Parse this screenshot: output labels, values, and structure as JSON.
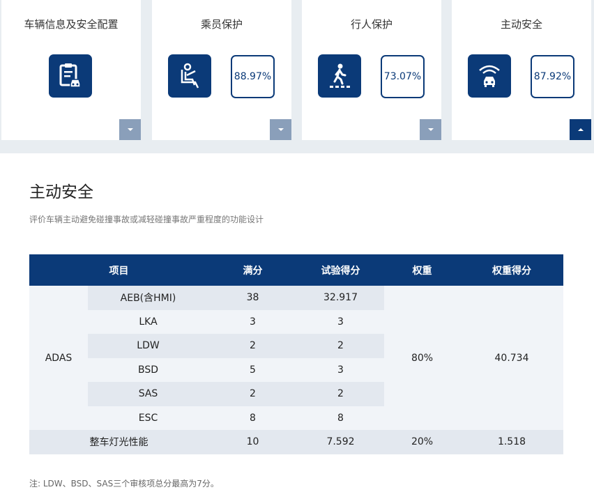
{
  "cards": [
    {
      "title": "车辆信息及安全配置",
      "icon": "clipboard-car-icon",
      "percent": "",
      "expanded": false
    },
    {
      "title": "乘员保护",
      "icon": "seated-occupant-icon",
      "percent": "88.97%",
      "expanded": false
    },
    {
      "title": "行人保护",
      "icon": "pedestrian-icon",
      "percent": "73.07%",
      "expanded": false
    },
    {
      "title": "主动安全",
      "icon": "car-radar-icon",
      "percent": "87.92%",
      "expanded": true
    }
  ],
  "section": {
    "title": "主动安全",
    "description": "评价车辆主动避免碰撞事故或减轻碰撞事故严重程度的功能设计",
    "note": "注: LDW、BSD、SAS三个审核项总分最高为7分。"
  },
  "table": {
    "headers": {
      "item": "项目",
      "full": "满分",
      "test": "试验得分",
      "weight": "权重",
      "weighted": "权重得分"
    },
    "group": {
      "name": "ADAS",
      "weight": "80%",
      "weighted": "40.734"
    },
    "rows": [
      {
        "name": "AEB(含HMI)",
        "full": "38",
        "test": "32.917"
      },
      {
        "name": "LKA",
        "full": "3",
        "test": "3"
      },
      {
        "name": "LDW",
        "full": "2",
        "test": "2"
      },
      {
        "name": "BSD",
        "full": "5",
        "test": "3"
      },
      {
        "name": "SAS",
        "full": "2",
        "test": "2"
      },
      {
        "name": "ESC",
        "full": "8",
        "test": "8"
      }
    ],
    "total": {
      "name": "整车灯光性能",
      "full": "10",
      "test": "7.592",
      "weight": "20%",
      "weighted": "1.518"
    }
  },
  "colors": {
    "accent": "#0b3a78",
    "toggle_inactive": "#8a9fba",
    "row_shade": "#e3e8ef"
  }
}
